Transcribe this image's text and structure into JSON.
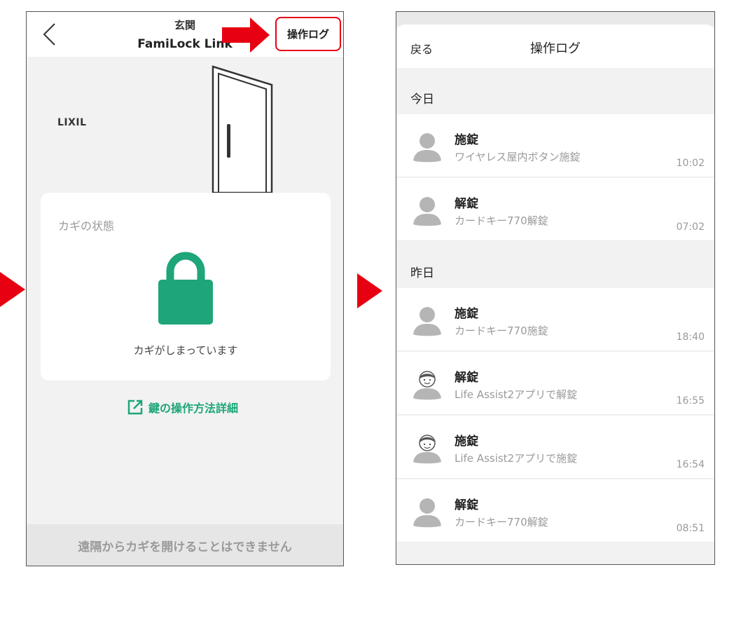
{
  "left": {
    "header_sub": "玄関",
    "header_title": "FamiLock Link",
    "log_button": "操作ログ",
    "brand": "LIXIL",
    "card_label": "カギの状態",
    "status_text": "カギがしまっています",
    "detail_link": "鍵の操作方法詳細",
    "remote_notice": "遠隔からカギを開けることはできません"
  },
  "right": {
    "back_label": "戻る",
    "title": "操作ログ",
    "sections": [
      {
        "heading": "今日",
        "items": [
          {
            "action": "施錠",
            "detail": "ワイヤレス屋内ボタン施錠",
            "time": "10:02",
            "avatar": "person-silhouette-icon"
          },
          {
            "action": "解錠",
            "detail": "カードキー770解錠",
            "time": "07:02",
            "avatar": "person-silhouette-icon"
          }
        ]
      },
      {
        "heading": "昨日",
        "items": [
          {
            "action": "施錠",
            "detail": "カードキー770施錠",
            "time": "18:40",
            "avatar": "person-silhouette-icon"
          },
          {
            "action": "解錠",
            "detail": "Life Assist2アプリで解錠",
            "time": "16:55",
            "avatar": "user-face-icon"
          },
          {
            "action": "施錠",
            "detail": "Life Assist2アプリで施錠",
            "time": "16:54",
            "avatar": "user-face-icon"
          },
          {
            "action": "解錠",
            "detail": "カードキー770解錠",
            "time": "08:51",
            "avatar": "person-silhouette-icon"
          }
        ]
      }
    ]
  },
  "colors": {
    "accent_green": "#1ea57a",
    "highlight_red": "#e60012"
  }
}
